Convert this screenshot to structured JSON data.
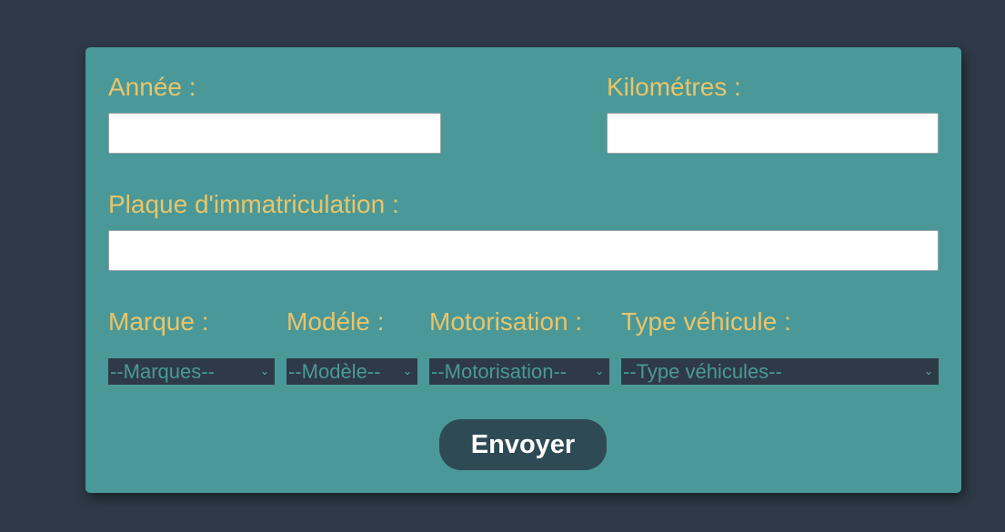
{
  "form": {
    "annee": {
      "label": "Année :",
      "value": ""
    },
    "kilometres": {
      "label": "Kilométres :",
      "value": ""
    },
    "plaque": {
      "label": "Plaque d'immatriculation :",
      "value": ""
    },
    "marque": {
      "label": "Marque :",
      "selected": "--Marques--"
    },
    "modele": {
      "label": "Modéle :",
      "selected": "--Modèle--"
    },
    "motorisation": {
      "label": "Motorisation :",
      "selected": "--Motorisation--"
    },
    "type_vehicule": {
      "label": "Type véhicule :",
      "selected": "--Type véhicules--"
    },
    "submit_label": "Envoyer"
  },
  "colors": {
    "page_background": "#2e3a47",
    "card_background": "#4a9998",
    "label_text": "#e9c46a",
    "select_background": "#2e3a47",
    "button_background": "#2e4a55",
    "button_text": "#ffffff"
  },
  "icons": {
    "select_arrow": "chevron-down-icon"
  }
}
